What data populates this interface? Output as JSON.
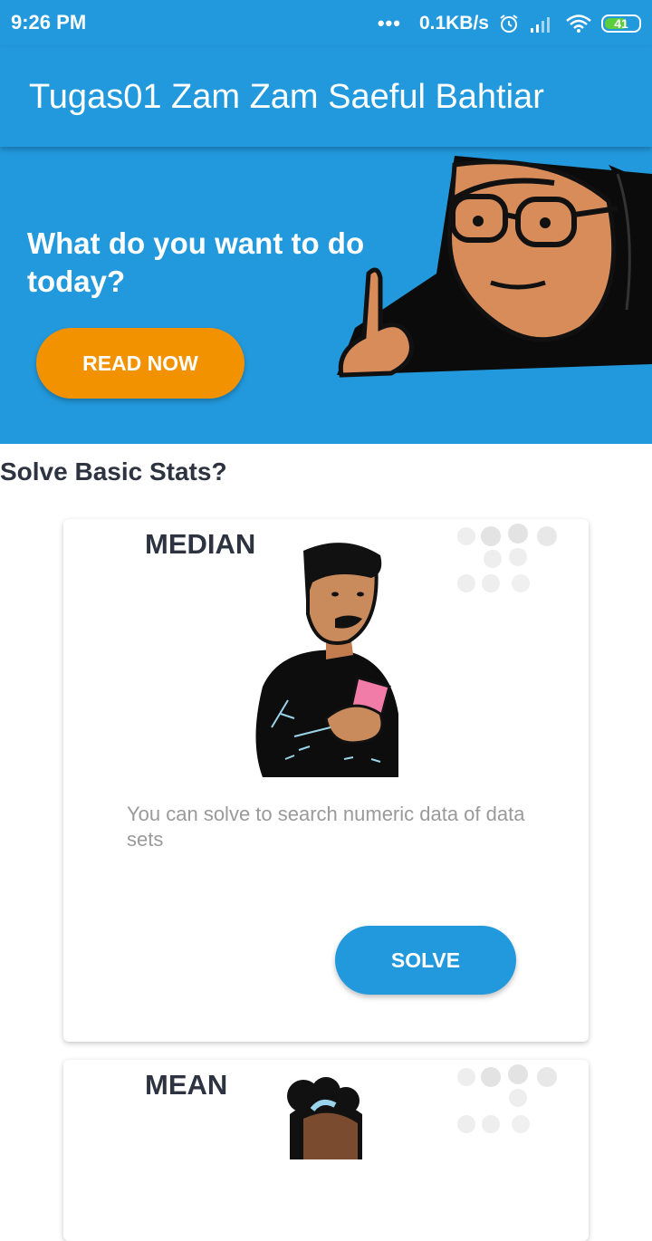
{
  "status": {
    "time": "9:26 PM",
    "dots": "•••",
    "speed": "0.1KB/s",
    "battery": "41",
    "icons": [
      "alarm-icon",
      "signal-icon",
      "wifi-icon",
      "battery-icon"
    ]
  },
  "app": {
    "title": "Tugas01 Zam Zam Saeful Bahtiar",
    "color": "#2299dd"
  },
  "banner": {
    "question": "What do you want to do today?",
    "button": "READ NOW",
    "button_color": "#f39200"
  },
  "section": {
    "title": "Solve Basic Stats?"
  },
  "cards": [
    {
      "title": "MEDIAN",
      "description": "You can solve to search numeric data of data sets",
      "button": "SOLVE"
    },
    {
      "title": "MEAN"
    }
  ]
}
